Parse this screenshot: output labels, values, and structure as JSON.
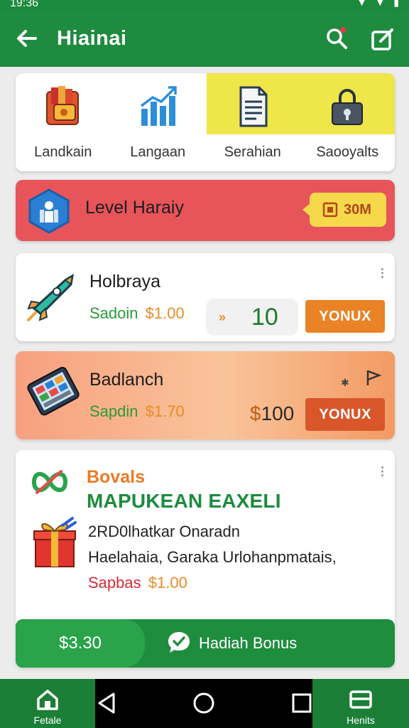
{
  "status": {
    "time": "19:36"
  },
  "appbar": {
    "title": "Hiainai",
    "back_icon": "arrow-left-icon",
    "search_icon": "search-icon",
    "edit_icon": "edit-icon"
  },
  "categories": [
    {
      "label": "Landkain",
      "icon": "wallet-icon",
      "active": false
    },
    {
      "label": "Langaan",
      "icon": "bar-chart-icon",
      "active": false
    },
    {
      "label": "Serahian",
      "icon": "document-icon",
      "active": true
    },
    {
      "label": "Saooyalts",
      "icon": "lock-icon",
      "active": true
    }
  ],
  "level": {
    "label": "Level Haraiy",
    "badge": "30M",
    "icon": "hex-badge-icon"
  },
  "offers": [
    {
      "name": "Holbraya",
      "sub_green": "Sadoin",
      "sub_price": "$1.00",
      "count_chevron": "»",
      "count": "10",
      "button": "YONUX",
      "icon": "rocket-icon"
    },
    {
      "name": "Badlanch",
      "sub_green": "Sapdin",
      "sub_price": "$1.70",
      "price_currency": "$",
      "price_value": "100",
      "button": "YONUX",
      "icon": "tablet-icon"
    }
  ],
  "bonus": {
    "title": "Bovals",
    "headline": "MAPUKEAN EAXELI",
    "line1": "2RD0lhatkar Onaradn",
    "line2": "Haelahaia, Garaka Urlohanpmatais,",
    "price_label": "Sapbas",
    "price": "$1.00",
    "bar_amount": "$3.30",
    "bar_label": "Hadiah Bonus"
  },
  "nav": {
    "left_label": "Fetale",
    "right_label": "Henits"
  },
  "colors": {
    "primary": "#1f8b3f",
    "accent_orange": "#ea8226",
    "level_red": "#e7545a",
    "highlight_yellow": "#efe64a"
  }
}
